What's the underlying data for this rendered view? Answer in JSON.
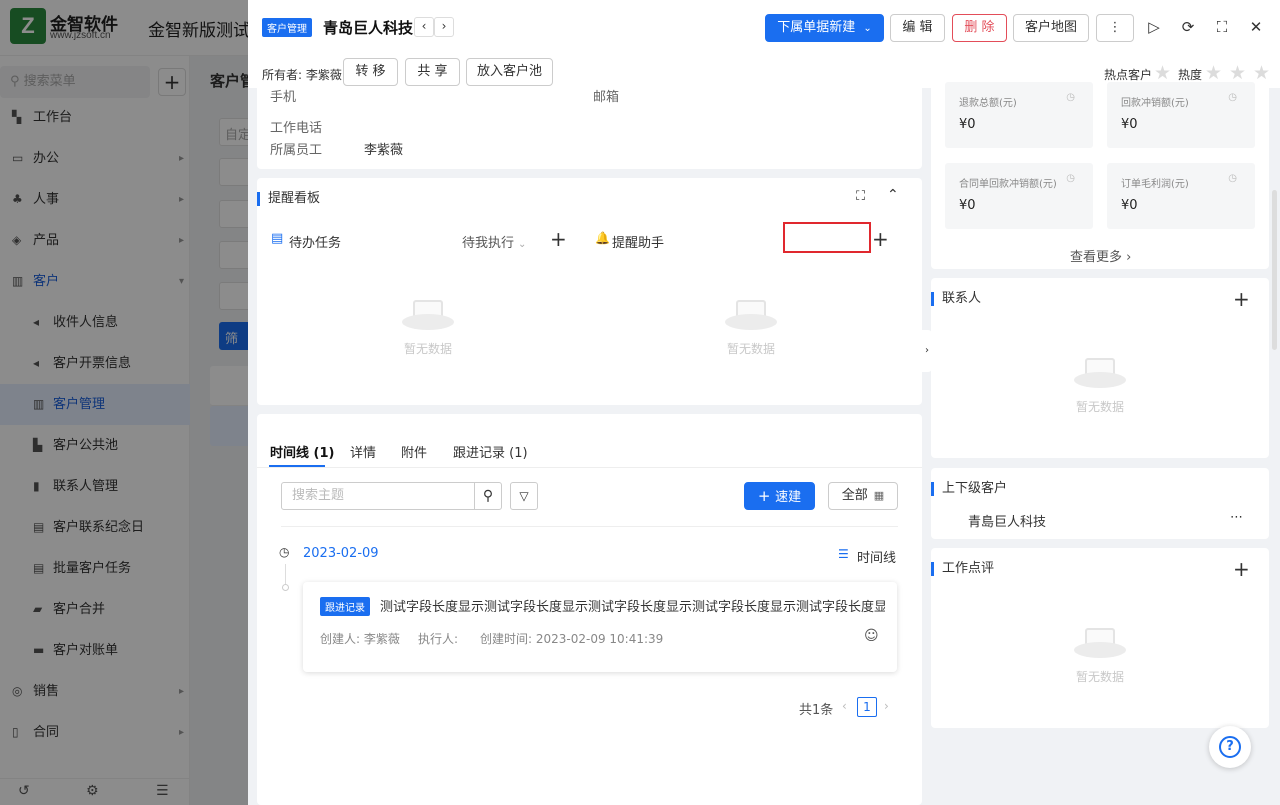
{
  "app": {
    "logo_mark": "Z",
    "logo_name": "金智软件",
    "logo_url": "www.jzsoft.cn",
    "title": "金智新版测试公"
  },
  "bg_sidebar": {
    "search_placeholder": "搜索菜单",
    "items": [
      {
        "icon": "▚",
        "label": "工作台",
        "arrow": ""
      },
      {
        "icon": "▭",
        "label": "办公",
        "arrow": "▸"
      },
      {
        "icon": "♣",
        "label": "人事",
        "arrow": "▸"
      },
      {
        "icon": "◈",
        "label": "产品",
        "arrow": "▸"
      },
      {
        "icon": "▥",
        "label": "客户",
        "arrow": "▾"
      },
      {
        "icon": "◂",
        "label": "收件人信息",
        "arrow": ""
      },
      {
        "icon": "◂",
        "label": "客户开票信息",
        "arrow": ""
      },
      {
        "icon": "▥",
        "label": "客户管理",
        "arrow": ""
      },
      {
        "icon": "▙",
        "label": "客户公共池",
        "arrow": ""
      },
      {
        "icon": "▮",
        "label": "联系人管理",
        "arrow": ""
      },
      {
        "icon": "▤",
        "label": "客户联系纪念日",
        "arrow": ""
      },
      {
        "icon": "▤",
        "label": "批量客户任务",
        "arrow": ""
      },
      {
        "icon": "▰",
        "label": "客户合并",
        "arrow": ""
      },
      {
        "icon": "▬",
        "label": "客户对账单",
        "arrow": ""
      },
      {
        "icon": "◎",
        "label": "销售",
        "arrow": "▸"
      },
      {
        "icon": "▯",
        "label": "合同",
        "arrow": "▸"
      }
    ]
  },
  "bg_main": {
    "title": "客户管",
    "input_text": "自定",
    "filter_btn": "筛"
  },
  "drawer": {
    "tag": "客户管理",
    "title": "青岛巨人科技",
    "prev_icon": "‹",
    "next_icon": "›",
    "buttons": {
      "new_sub": "下属单据新建",
      "edit": "编 辑",
      "delete": "删 除",
      "map": "客户地图",
      "more": "⋮"
    },
    "owner_label": "所有者: 李紫薇",
    "actions": [
      "转 移",
      "共 享",
      "放入客户池"
    ],
    "hot_customer_label": "热点客户",
    "heat_label": "热度",
    "heat_stars": 0
  },
  "info": {
    "mobile_label": "手机",
    "email_label": "邮箱",
    "work_phone_label": "工作电话",
    "employee_label": "所属员工",
    "employee_value": "李紫薇"
  },
  "reminder": {
    "title": "提醒看板",
    "todo_label": "待办任务",
    "todo_filter": "待我执行",
    "assistant_label": "提醒助手",
    "empty_text": "暂无数据"
  },
  "timeline": {
    "tabs": [
      "时间线 (1)",
      "详情",
      "附件",
      "跟进记录 (1)"
    ],
    "search_placeholder": "搜索主题",
    "quick_new": "速建",
    "all_label": "全部",
    "date": "2023-02-09",
    "view_label": "时间线",
    "entry": {
      "tag": "跟进记录",
      "text": "测试字段长度显示测试字段长度显示测试字段长度显示测试字段长度显示测试字段长度显示测...",
      "creator": "创建人: 李紫薇",
      "executor": "执行人:",
      "created_time": "创建时间: 2023-02-09 10:41:39"
    },
    "total": "共1条",
    "page": "1"
  },
  "stats": [
    {
      "label": "退款总额(元)",
      "value": "¥0"
    },
    {
      "label": "回款冲销额(元)",
      "value": "¥0"
    },
    {
      "label": "合同单回款冲销额(元)",
      "value": "¥0"
    },
    {
      "label": "订单毛利润(元)",
      "value": "¥0"
    }
  ],
  "see_more": "查看更多",
  "contacts": {
    "title": "联系人",
    "empty_text": "暂无数据"
  },
  "parent_child": {
    "title": "上下级客户",
    "item": "青島巨人科技"
  },
  "comments": {
    "title": "工作点评",
    "empty_text": "暂无数据"
  },
  "colors": {
    "primary": "#1a6ef0",
    "danger": "#e34d59",
    "highlight_box": "#e0282e"
  }
}
